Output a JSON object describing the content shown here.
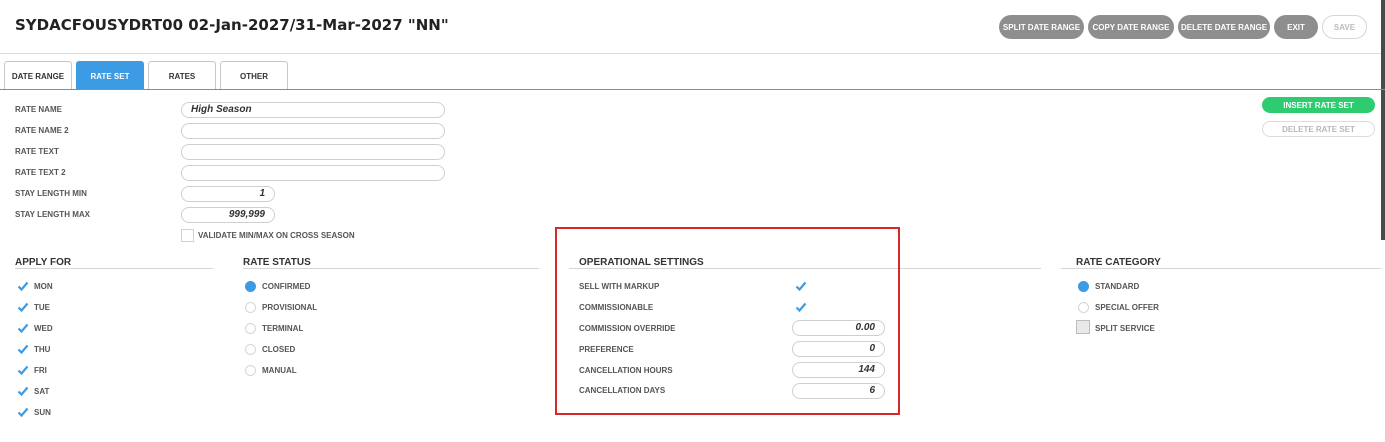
{
  "header": {
    "title": "SYDACFOUSYDRT00 02-Jan-2027/31-Mar-2027 \"NN\"",
    "buttons": {
      "split": "SPLIT DATE RANGE",
      "copy": "COPY DATE RANGE",
      "delete": "DELETE DATE RANGE",
      "exit": "EXIT",
      "save": "SAVE"
    }
  },
  "tabs": {
    "date_range": "DATE RANGE",
    "rate_set": "RATE SET",
    "rates": "RATES",
    "other": "OTHER"
  },
  "form": {
    "rate_name_label": "RATE NAME",
    "rate_name_value": "High Season",
    "rate_name2_label": "RATE NAME 2",
    "rate_name2_value": "",
    "rate_text_label": "RATE TEXT",
    "rate_text_value": "",
    "rate_text2_label": "RATE TEXT 2",
    "rate_text2_value": "",
    "stay_min_label": "STAY LENGTH MIN",
    "stay_min_value": "1",
    "stay_max_label": "STAY LENGTH MAX",
    "stay_max_value": "999,999",
    "validate_label": "VALIDATE MIN/MAX ON CROSS SEASON"
  },
  "actions": {
    "insert": "INSERT RATE SET",
    "delete": "DELETE RATE SET"
  },
  "apply_for": {
    "title": "APPLY FOR",
    "days": [
      "MON",
      "TUE",
      "WED",
      "THU",
      "FRI",
      "SAT",
      "SUN"
    ]
  },
  "rate_status": {
    "title": "RATE STATUS",
    "options": [
      "CONFIRMED",
      "PROVISIONAL",
      "TERMINAL",
      "CLOSED",
      "MANUAL"
    ]
  },
  "operational": {
    "title": "OPERATIONAL SETTINGS",
    "sell_with_markup": "SELL WITH MARKUP",
    "commissionable": "COMMISSIONABLE",
    "commission_override_label": "COMMISSION OVERRIDE",
    "commission_override_value": "0.00",
    "preference_label": "PREFERENCE",
    "preference_value": "0",
    "cancel_hours_label": "CANCELLATION HOURS",
    "cancel_hours_value": "144",
    "cancel_days_label": "CANCELLATION DAYS",
    "cancel_days_value": "6"
  },
  "rate_category": {
    "title": "RATE CATEGORY",
    "standard": "STANDARD",
    "special_offer": "SPECIAL OFFER",
    "split_service": "SPLIT SERVICE"
  },
  "colors": {
    "accent": "#3d9be3",
    "green": "#2ecc71",
    "highlight": "#d62828"
  }
}
